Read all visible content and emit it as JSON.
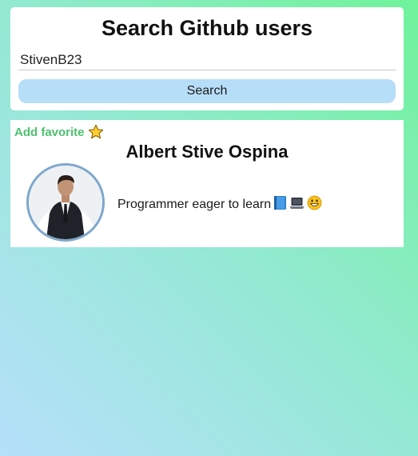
{
  "search": {
    "title": "Search Github users",
    "input_value": "StivenB23",
    "button_label": "Search"
  },
  "profile": {
    "favorite_label": "Add favorite",
    "favorite_icon": "star-icon",
    "name": "Albert Stive Ospina",
    "bio": "Programmer eager to learn",
    "bio_icons": [
      "book-icon",
      "laptop-icon",
      "grinning-face-icon"
    ]
  },
  "colors": {
    "button_bg": "#b7def9",
    "favorite_text": "#4cc26f",
    "avatar_border": "#7da7cc"
  }
}
